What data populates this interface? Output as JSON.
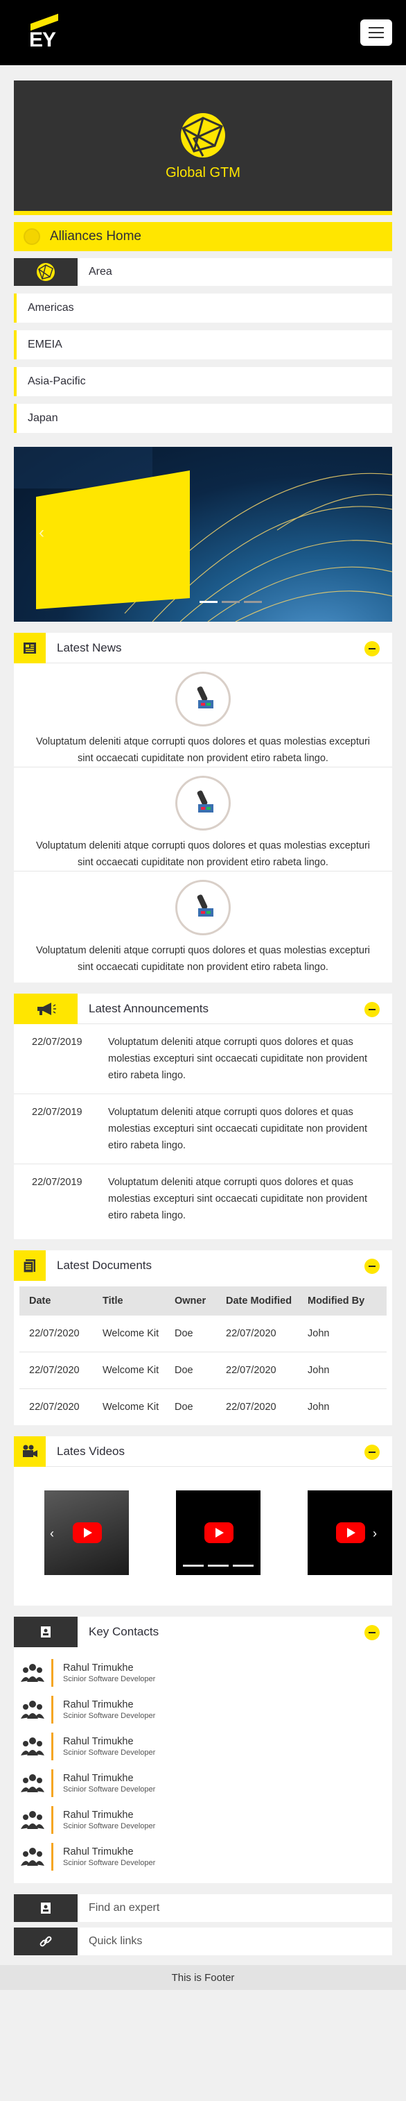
{
  "header": {
    "logo_text": "EY"
  },
  "banner": {
    "title": "Global GTM"
  },
  "nav": {
    "alliances_home": "Alliances Home",
    "area_label": "Area",
    "regions": [
      "Americas",
      "EMEIA",
      "Asia-Pacific",
      "Japan"
    ]
  },
  "news": {
    "title": "Latest News",
    "items": [
      "Voluptatum deleniti atque corrupti quos dolores et quas molestias excepturi sint occaecati cupiditate non provident etiro rabeta lingo.",
      "Voluptatum deleniti atque corrupti quos dolores et quas molestias excepturi sint occaecati cupiditate non provident etiro rabeta lingo.",
      "Voluptatum deleniti atque corrupti quos dolores et quas molestias excepturi sint occaecati cupiditate non provident etiro rabeta lingo."
    ]
  },
  "announcements": {
    "title": "Latest Announcements",
    "items": [
      {
        "date": "22/07/2019",
        "text": "Voluptatum deleniti atque corrupti quos dolores et quas molestias excepturi sint occaecati cupiditate non provident etiro rabeta lingo."
      },
      {
        "date": "22/07/2019",
        "text": "Voluptatum deleniti atque corrupti quos dolores et quas molestias excepturi sint occaecati cupiditate non provident etiro rabeta lingo."
      },
      {
        "date": "22/07/2019",
        "text": "Voluptatum deleniti atque corrupti quos dolores et quas molestias excepturi sint occaecati cupiditate non provident etiro rabeta lingo."
      }
    ]
  },
  "documents": {
    "title": "Latest Documents",
    "columns": [
      "Date",
      "Title",
      "Owner",
      "Date Modified",
      "Modified By"
    ],
    "rows": [
      [
        "22/07/2020",
        "Welcome Kit",
        "Doe",
        "22/07/2020",
        "John"
      ],
      [
        "22/07/2020",
        "Welcome Kit",
        "Doe",
        "22/07/2020",
        "John"
      ],
      [
        "22/07/2020",
        "Welcome Kit",
        "Doe",
        "22/07/2020",
        "John"
      ]
    ]
  },
  "videos": {
    "title": "Lates Videos"
  },
  "contacts": {
    "title": "Key Contacts",
    "items": [
      {
        "name": "Rahul Trimukhe",
        "role": "Scinior Software Developer"
      },
      {
        "name": "Rahul Trimukhe",
        "role": "Scinior Software Developer"
      },
      {
        "name": "Rahul Trimukhe",
        "role": "Scinior Software Developer"
      },
      {
        "name": "Rahul Trimukhe",
        "role": "Scinior Software Developer"
      },
      {
        "name": "Rahul Trimukhe",
        "role": "Scinior Software Developer"
      },
      {
        "name": "Rahul Trimukhe",
        "role": "Scinior Software Developer"
      }
    ]
  },
  "links": {
    "find_expert": "Find an expert",
    "quick_links": "Quick links"
  },
  "footer": {
    "text": "This is Footer"
  },
  "colors": {
    "accent": "#ffe600",
    "dark": "#333333"
  }
}
